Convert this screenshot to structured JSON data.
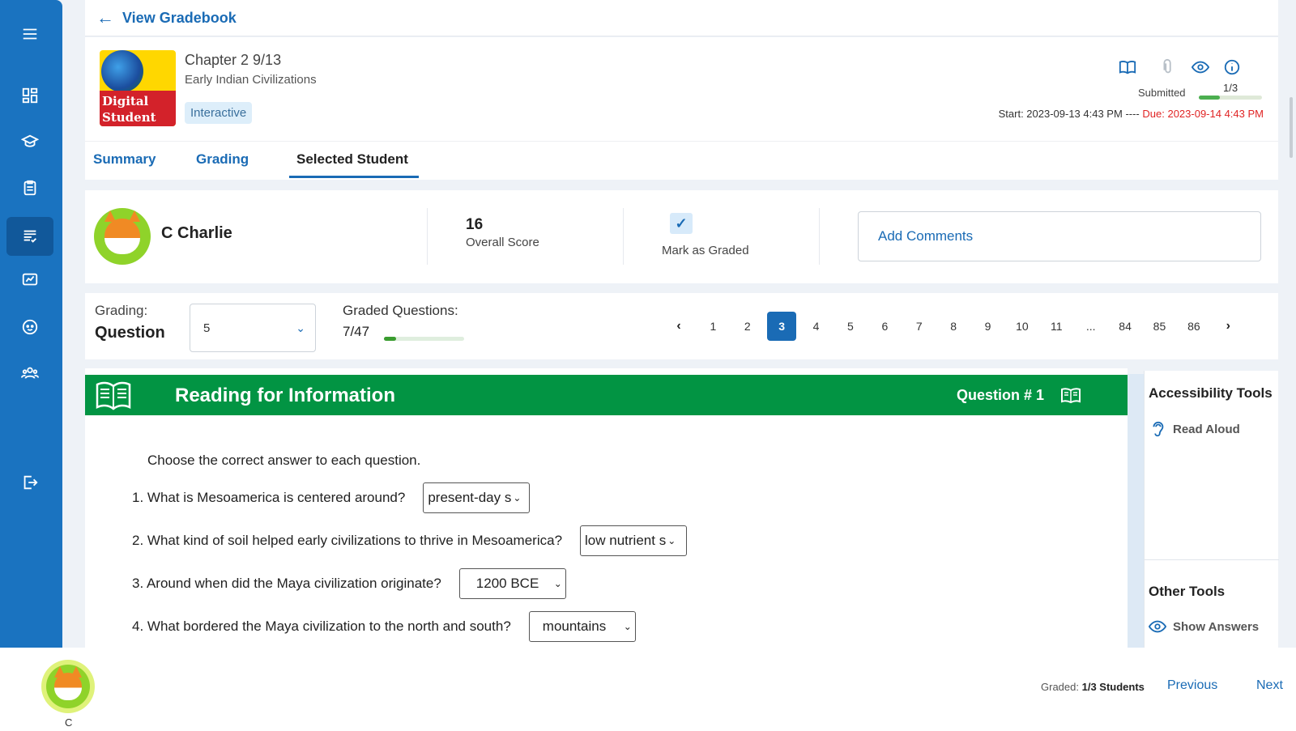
{
  "nav": {
    "back_label": "View Gradebook",
    "items": [
      {
        "icon": "menu-icon"
      },
      {
        "icon": "dashboard-icon"
      },
      {
        "icon": "graduation-cap-icon"
      },
      {
        "icon": "clipboard-icon"
      },
      {
        "icon": "assignments-icon",
        "active": true
      },
      {
        "icon": "chat-chart-icon"
      },
      {
        "icon": "face-icon"
      },
      {
        "icon": "group-icon"
      },
      {
        "icon": "logout-icon"
      }
    ]
  },
  "assignment": {
    "cover_text": "Digital Student Book",
    "title": "Chapter 2 9/13",
    "subtitle": "Early Indian Civilizations",
    "tag": "Interactive",
    "icons": [
      "book-icon",
      "paperclip-icon",
      "eye-icon",
      "info-icon"
    ],
    "submitted_label": "Submitted",
    "submitted_fraction": "1/3",
    "submitted_progress": 0.33,
    "start": "Start: 2023-09-13 4:43 PM",
    "separator": "----",
    "due": "Due: 2023-09-14 4:43 PM"
  },
  "tabs": [
    {
      "label": "Summary"
    },
    {
      "label": "Grading"
    },
    {
      "label": "Selected Student",
      "active": true
    }
  ],
  "student": {
    "name": "C Charlie",
    "score": "16",
    "score_label": "Overall Score",
    "graded_label": "Mark as Graded",
    "graded_checked": true,
    "comments_label": "Add Comments"
  },
  "grading": {
    "label": "Grading:",
    "mode": "Question",
    "selected": "5",
    "graded_label": "Graded Questions:",
    "graded_value": "7/47",
    "graded_progress": 0.149,
    "pages": [
      "1",
      "2",
      "3",
      "4",
      "5",
      "6",
      "7",
      "8",
      "9",
      "10",
      "11",
      "...",
      "84",
      "85",
      "86"
    ],
    "current_page": "3"
  },
  "question": {
    "section_title": "Reading for Information",
    "number_label": "Question # 1",
    "instructions": "Choose the correct answer to each question.",
    "items": [
      {
        "text": "1. What is Mesoamerica is centered around?",
        "answer": "present-day s"
      },
      {
        "text": "2. What kind of soil helped early civilizations to thrive in Mesoamerica?",
        "answer": "low nutrient s"
      },
      {
        "text": "3. Around when did the Maya civilization originate?",
        "answer": "1200 BCE"
      },
      {
        "text": "4. What bordered the Maya civilization to the north and south?",
        "answer": "mountains"
      }
    ]
  },
  "tools": {
    "accessibility_title": "Accessibility Tools",
    "read_aloud": "Read Aloud",
    "other_title": "Other Tools",
    "show_answers": "Show Answers"
  },
  "footer": {
    "student_initial": "C",
    "graded_label": "Graded:",
    "graded_value": "1/3 Students",
    "previous": "Previous",
    "next": "Next"
  },
  "colors": {
    "sidebar": "#1a73c0",
    "accent": "#1a6bb5",
    "header_green": "#029443",
    "due_red": "#e02424",
    "progress_green": "#4caf50"
  }
}
